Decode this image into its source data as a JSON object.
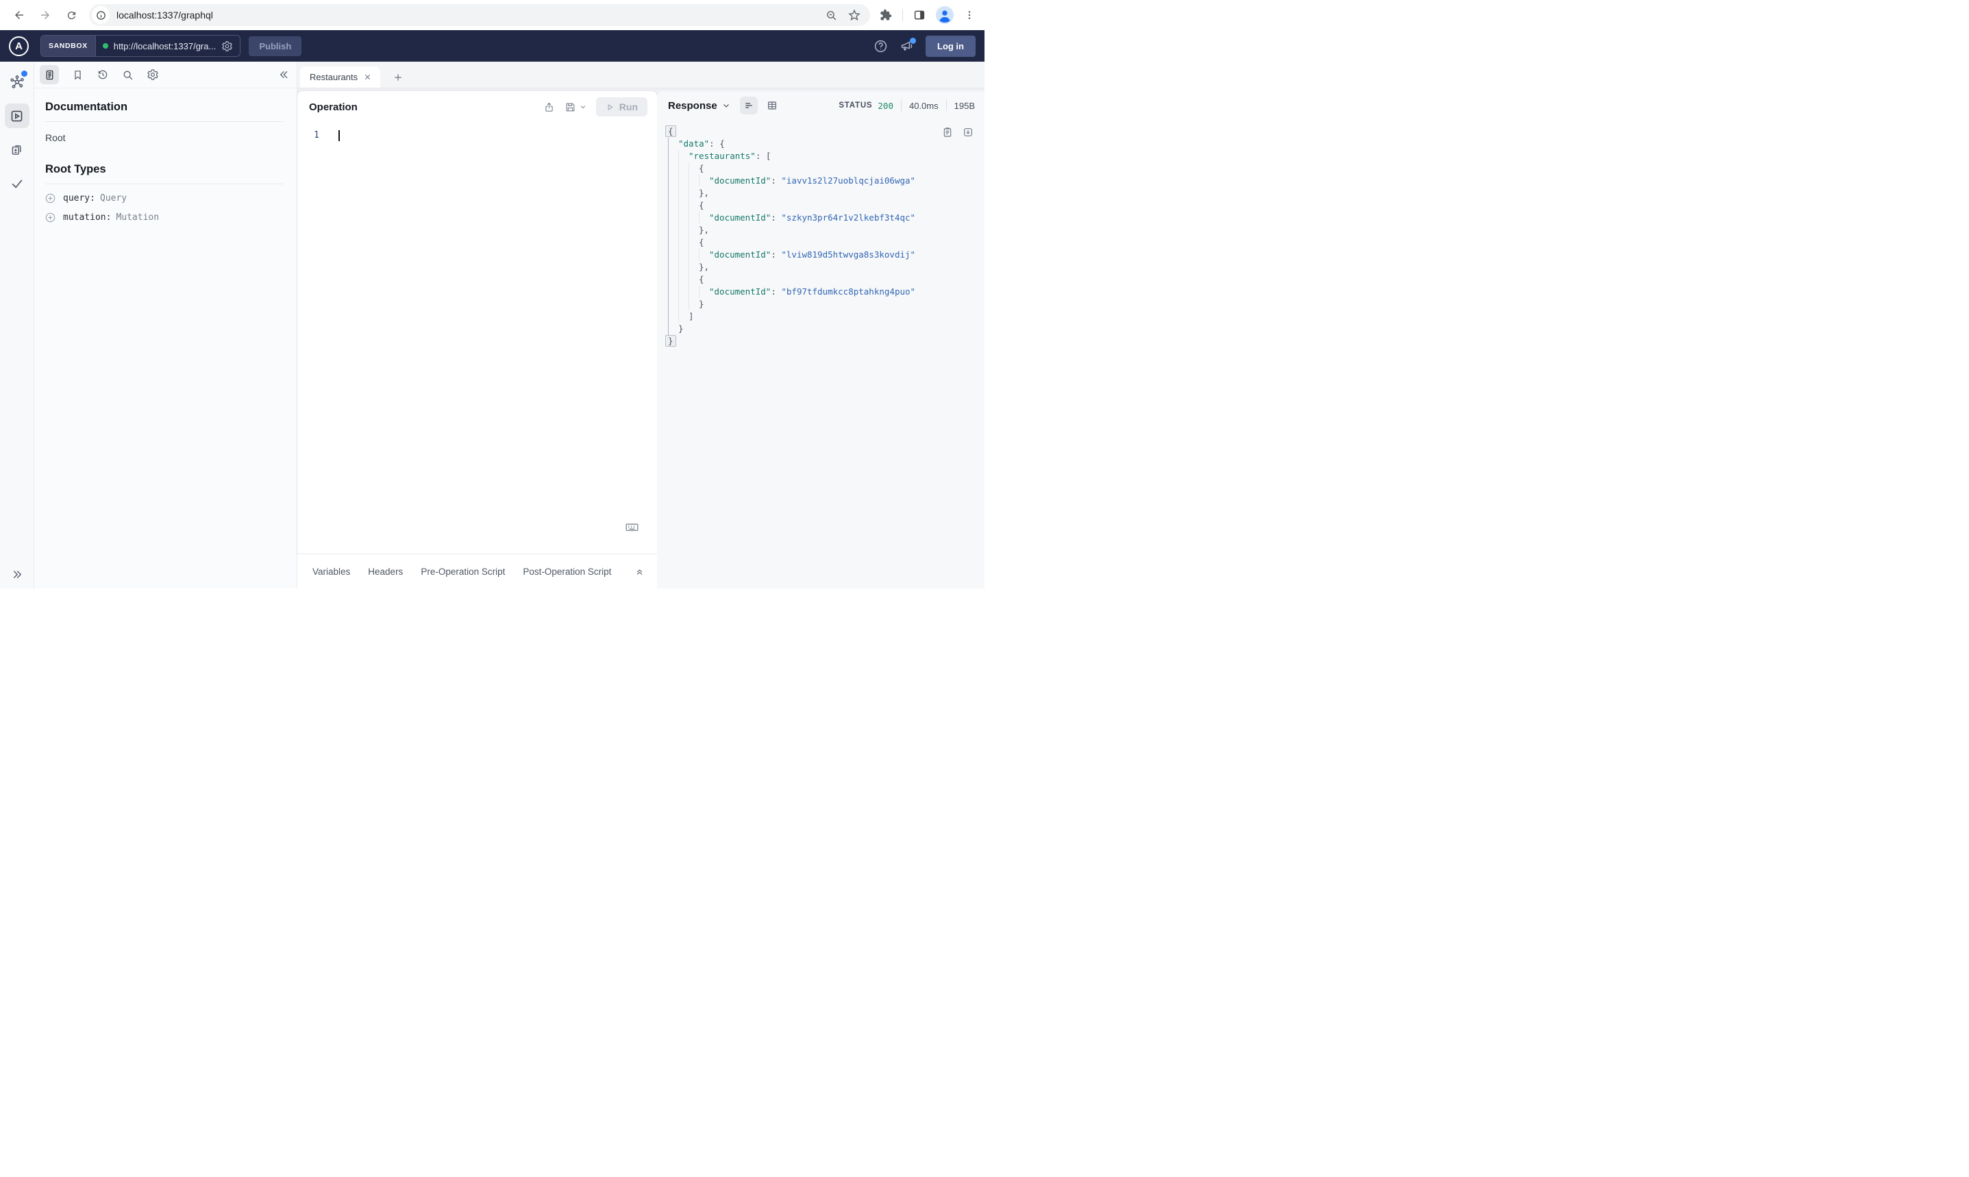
{
  "browser": {
    "url": "localhost:1337/graphql"
  },
  "app_header": {
    "logo_letter": "A",
    "env_label": "SANDBOX",
    "endpoint_url": "http://localhost:1337/gra...",
    "publish_label": "Publish",
    "login_label": "Log in"
  },
  "doc_panel": {
    "title": "Documentation",
    "root_label": "Root",
    "root_types_title": "Root Types",
    "fields": [
      {
        "name": "query:",
        "type": "Query"
      },
      {
        "name": "mutation:",
        "type": "Mutation"
      }
    ]
  },
  "tabs": {
    "active_label": "Restaurants"
  },
  "operation": {
    "title": "Operation",
    "run_label": "Run",
    "line_number": "1"
  },
  "response": {
    "title": "Response",
    "status_label": "STATUS",
    "status_code": "200",
    "duration": "40.0ms",
    "size": "195B",
    "json_lines": [
      {
        "ind": 0,
        "fold": true,
        "tokens": [
          [
            "p",
            "{"
          ]
        ]
      },
      {
        "ind": 1,
        "tokens": [
          [
            "k",
            "\"data\""
          ],
          [
            "p",
            ": {"
          ]
        ]
      },
      {
        "ind": 2,
        "tokens": [
          [
            "k",
            "\"restaurants\""
          ],
          [
            "p",
            ": ["
          ]
        ]
      },
      {
        "ind": 3,
        "tokens": [
          [
            "p",
            "{"
          ]
        ]
      },
      {
        "ind": 4,
        "tokens": [
          [
            "k",
            "\"documentId\""
          ],
          [
            "p",
            ": "
          ],
          [
            "s",
            "\"iavv1s2l27uoblqcjai06wga\""
          ]
        ]
      },
      {
        "ind": 3,
        "tokens": [
          [
            "p",
            "},"
          ]
        ]
      },
      {
        "ind": 3,
        "tokens": [
          [
            "p",
            "{"
          ]
        ]
      },
      {
        "ind": 4,
        "tokens": [
          [
            "k",
            "\"documentId\""
          ],
          [
            "p",
            ": "
          ],
          [
            "s",
            "\"szkyn3pr64r1v2lkebf3t4qc\""
          ]
        ]
      },
      {
        "ind": 3,
        "tokens": [
          [
            "p",
            "},"
          ]
        ]
      },
      {
        "ind": 3,
        "tokens": [
          [
            "p",
            "{"
          ]
        ]
      },
      {
        "ind": 4,
        "tokens": [
          [
            "k",
            "\"documentId\""
          ],
          [
            "p",
            ": "
          ],
          [
            "s",
            "\"lviw819d5htwvga8s3kovdij\""
          ]
        ]
      },
      {
        "ind": 3,
        "tokens": [
          [
            "p",
            "},"
          ]
        ]
      },
      {
        "ind": 3,
        "tokens": [
          [
            "p",
            "{"
          ]
        ]
      },
      {
        "ind": 4,
        "tokens": [
          [
            "k",
            "\"documentId\""
          ],
          [
            "p",
            ": "
          ],
          [
            "s",
            "\"bf97tfdumkcc8ptahkng4puo\""
          ]
        ]
      },
      {
        "ind": 3,
        "tokens": [
          [
            "p",
            "}"
          ]
        ]
      },
      {
        "ind": 2,
        "tokens": [
          [
            "p",
            "]"
          ]
        ]
      },
      {
        "ind": 1,
        "tokens": [
          [
            "p",
            "}"
          ]
        ]
      },
      {
        "ind": 0,
        "fold": true,
        "tokens": [
          [
            "p",
            "}"
          ]
        ]
      }
    ]
  },
  "bottom_bar": {
    "tabs": [
      "Variables",
      "Headers",
      "Pre-Operation Script",
      "Post-Operation Script"
    ]
  },
  "colors": {
    "header_bg": "#212845",
    "status_ok": "#1f8a63",
    "accent_blue": "#2f7cf6",
    "online_dot": "#2fbf71",
    "json_key": "#15796a",
    "json_string": "#3267b4"
  }
}
